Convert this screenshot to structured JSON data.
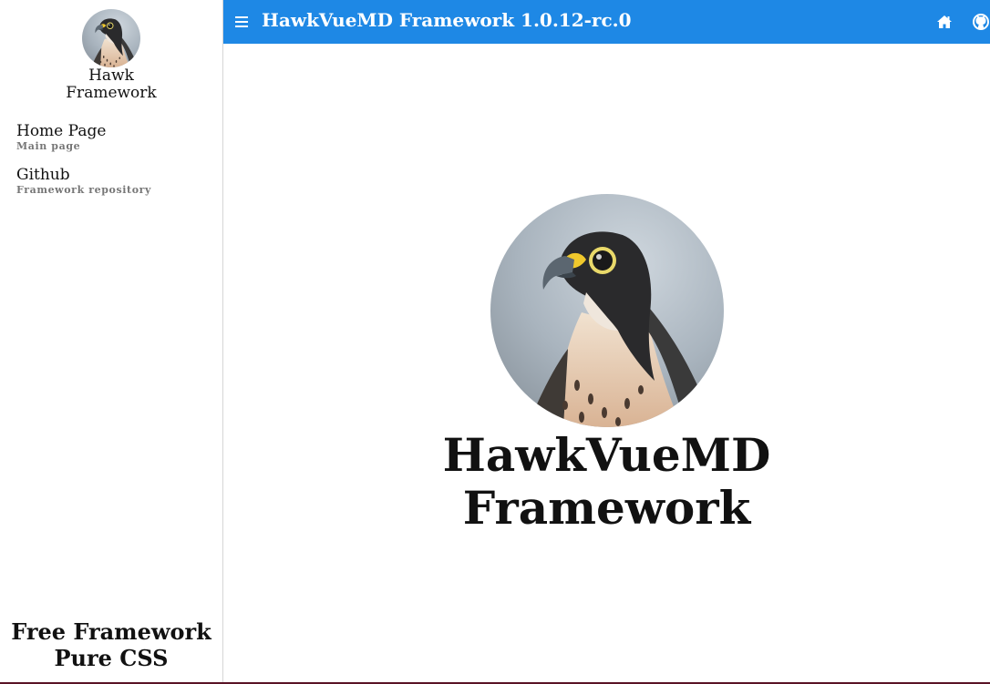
{
  "app": {
    "title": "HawkVueMD Framework 1.0.12-rc.0"
  },
  "sidebar": {
    "brand_line1": "Hawk",
    "brand_line2": "Framework",
    "items": [
      {
        "label": "Home Page",
        "sublabel": "Main page"
      },
      {
        "label": "Github",
        "sublabel": "Framework repository"
      }
    ],
    "footer_line1": "Free Framework",
    "footer_line2": "Pure CSS"
  },
  "topbar": {
    "icons": [
      "menu-icon",
      "home-icon",
      "github-icon"
    ]
  },
  "hero": {
    "title_line1": "HawkVueMD",
    "title_line2": "Framework"
  },
  "colors": {
    "accent": "#1e88e5",
    "bottom_border": "#5a1426"
  }
}
